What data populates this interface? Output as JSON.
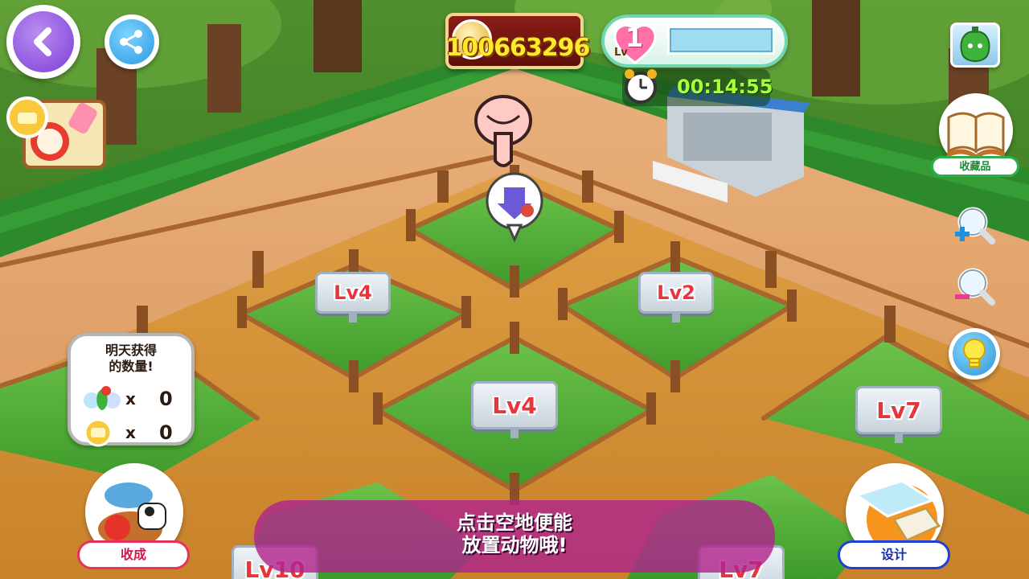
{
  "currency": {
    "value": "100663296",
    "icon": "coin-icon"
  },
  "level": {
    "number": "1",
    "lv_label": "Lv",
    "progress": 0.0
  },
  "timer": {
    "value": "00:14:55",
    "icon": "alarm-clock-icon"
  },
  "top_left": {
    "back_icon": "back-arrow-icon",
    "share_icon": "share-icon",
    "recipe_icon": "recipe-book-icon"
  },
  "right_panel": {
    "pepper_icon": "green-pepper-icon",
    "collection_label": "收藏品",
    "zoom_in_icon": "zoom-in-icon",
    "zoom_out_icon": "zoom-out-icon",
    "hint_icon": "lightbulb-icon"
  },
  "pens": [
    {
      "label": "Lv4"
    },
    {
      "label": "Lv2"
    },
    {
      "label": "Lv4"
    },
    {
      "label": "Lv7"
    },
    {
      "label": "Lv10"
    },
    {
      "label": "Lv7"
    }
  ],
  "tomorrow": {
    "title": "明天获得\n的数量!",
    "rows": [
      {
        "icon": "vegetables-icon",
        "x": "x",
        "value": "0"
      },
      {
        "icon": "coin-icon",
        "x": "x",
        "value": "0"
      }
    ]
  },
  "bottom": {
    "harvest_label": "收成",
    "design_label": "设计",
    "tip": "点击空地便能\n放置动物哦!"
  },
  "colors": {
    "currency_text": "#ffe92c",
    "timer_text": "#a7ff3a",
    "tip_banner": "#b0248c",
    "harvest_border": "#e6335c",
    "design_border": "#1f3fd6",
    "collection_border": "#2bb04a"
  }
}
